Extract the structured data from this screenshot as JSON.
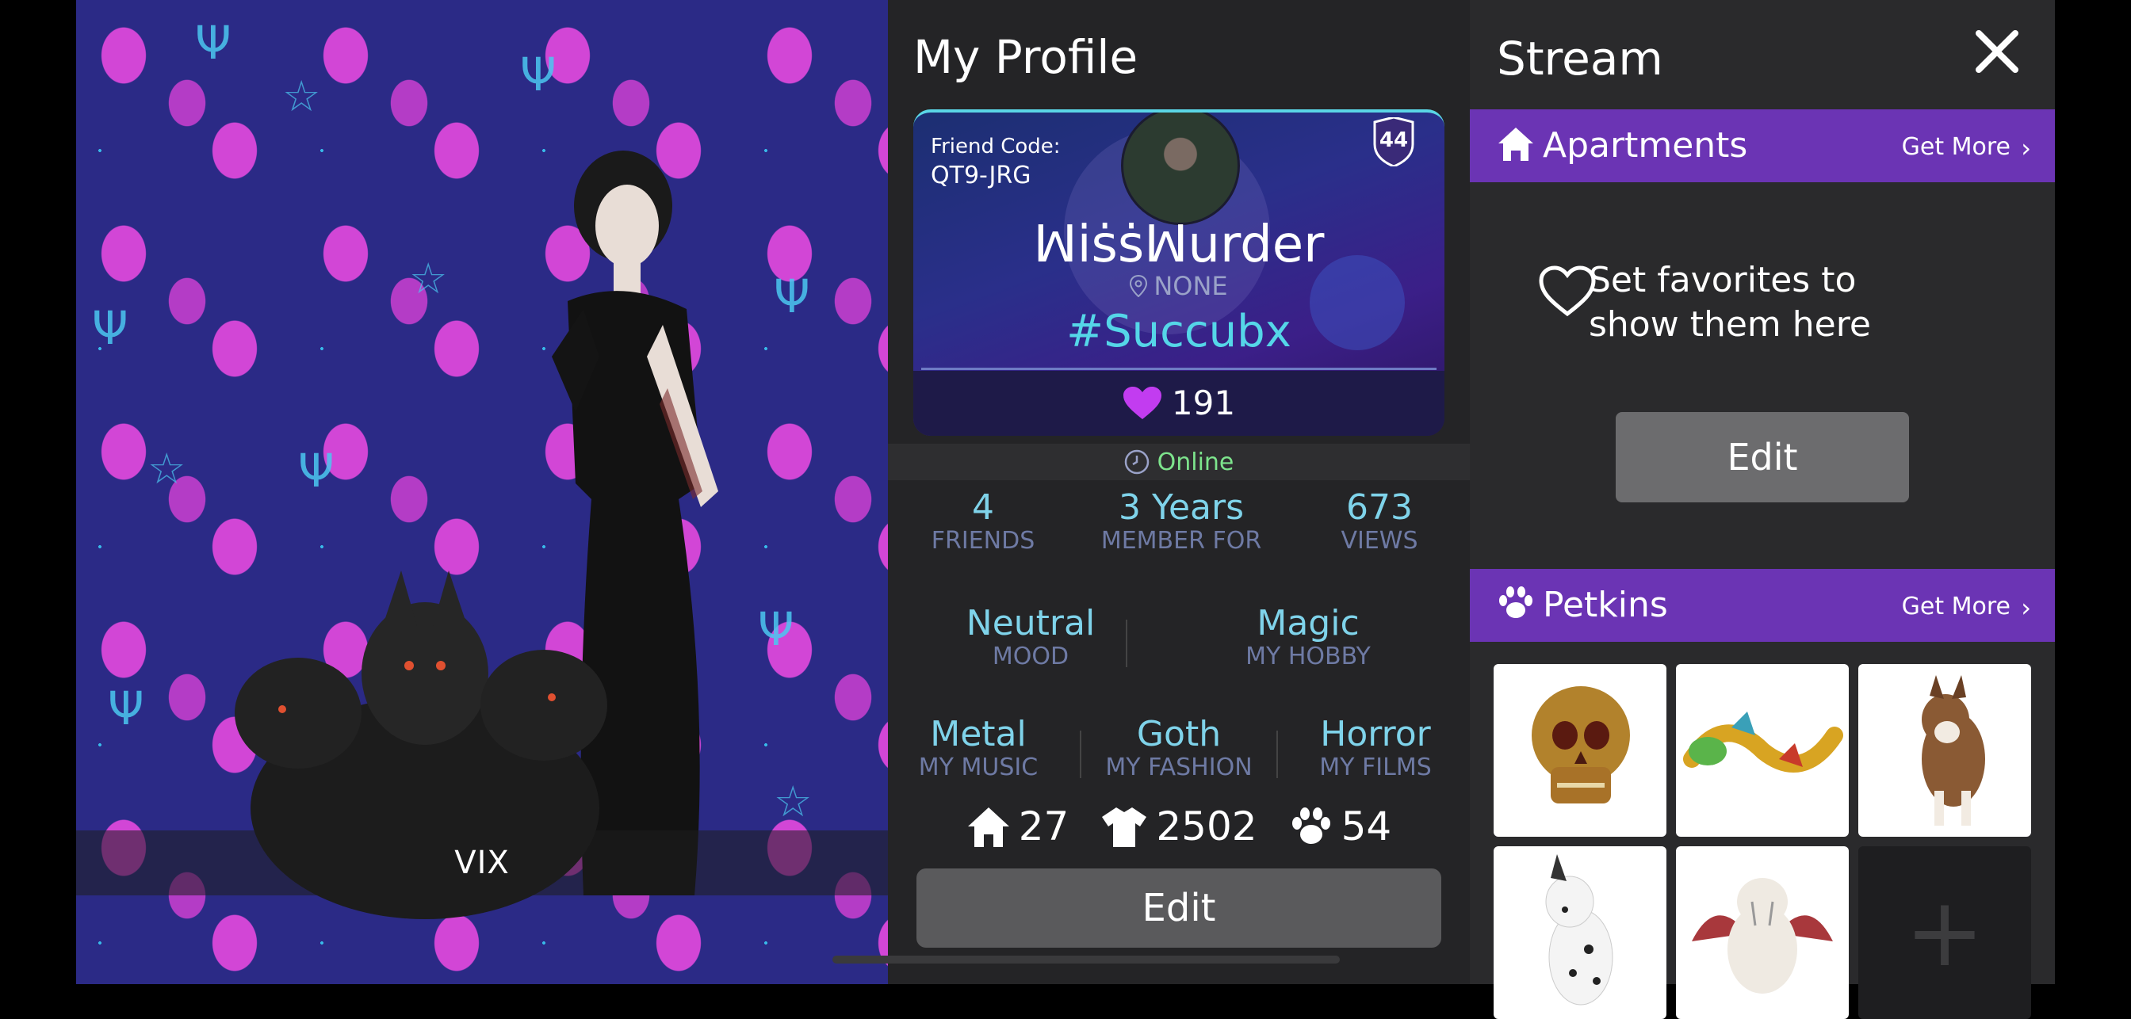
{
  "avatar": {
    "name": "VIX"
  },
  "profile": {
    "title": "My Profile",
    "friend_code_label": "Friend Code:",
    "friend_code": "QT9-JRG",
    "level": "44",
    "username": "ꟽı̇ṡṡꟽurder",
    "location": "NONE",
    "hashtag": "#Succubx",
    "likes": "191",
    "status": "Online",
    "stats": [
      {
        "value": "4",
        "label": "FRIENDS"
      },
      {
        "value": "3 Years",
        "label": "MEMBER FOR"
      },
      {
        "value": "673",
        "label": "VIEWS"
      }
    ],
    "mood": {
      "value": "Neutral",
      "label": "MOOD"
    },
    "hobby": {
      "value": "Magic",
      "label": "MY HOBBY"
    },
    "music": {
      "value": "Metal",
      "label": "MY MUSIC"
    },
    "fashion": {
      "value": "Goth",
      "label": "MY FASHION"
    },
    "films": {
      "value": "Horror",
      "label": "MY FILMS"
    },
    "counts": {
      "apartments": "27",
      "clothing": "2502",
      "pets": "54"
    },
    "edit_label": "Edit"
  },
  "stream": {
    "title": "Stream",
    "apartments": {
      "title": "Apartments",
      "get_more": "Get More"
    },
    "favorites_message": "Set favorites to show them here",
    "edit_label": "Edit",
    "petkins": {
      "title": "Petkins",
      "get_more": "Get More"
    },
    "pets": [
      "skull-pet",
      "dragon-pet",
      "husky-pet",
      "dalmatian-pet",
      "winged-tiger-pet"
    ]
  },
  "colors": {
    "accent_purple": "#6b34b4",
    "cyan": "#55d6e8",
    "online_green": "#7de48c",
    "heart_magenta": "#c23cf0"
  }
}
